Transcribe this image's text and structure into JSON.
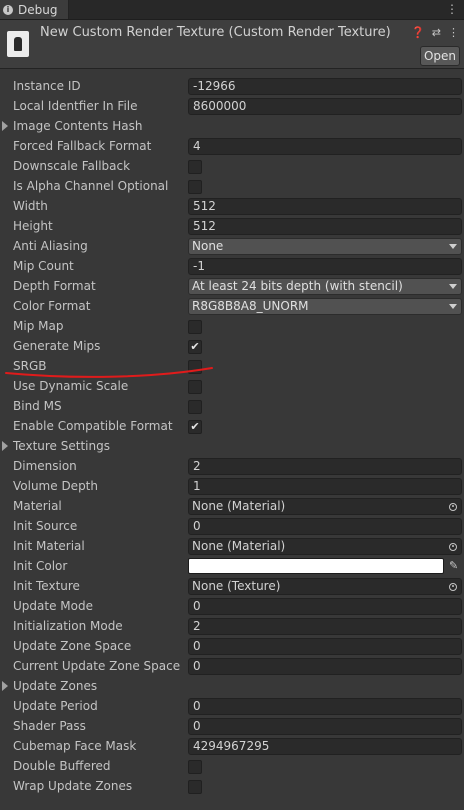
{
  "tab": {
    "label": "Debug",
    "menu_icon": "kebab-menu-icon"
  },
  "header": {
    "title": "New Custom Render Texture (Custom Render Texture)",
    "open_label": "Open",
    "icons": [
      "help-icon",
      "settings-sliders-icon",
      "more-icon"
    ]
  },
  "rows": {
    "instance_id": {
      "label": "Instance ID",
      "value": "-12966"
    },
    "local_identifier": {
      "label": "Local Identfier In File",
      "value": "8600000"
    },
    "image_contents_hash": {
      "label": "Image Contents Hash"
    },
    "forced_fallback_format": {
      "label": "Forced Fallback Format",
      "value": "4"
    },
    "downscale_fallback": {
      "label": "Downscale Fallback",
      "checked": false
    },
    "is_alpha_optional": {
      "label": "Is Alpha Channel Optional",
      "checked": false
    },
    "width": {
      "label": "Width",
      "value": "512"
    },
    "height": {
      "label": "Height",
      "value": "512"
    },
    "anti_aliasing": {
      "label": "Anti Aliasing",
      "value": "None"
    },
    "mip_count": {
      "label": "Mip Count",
      "value": "-1"
    },
    "depth_format": {
      "label": "Depth Format",
      "value": "At least 24 bits depth (with stencil)"
    },
    "color_format": {
      "label": "Color Format",
      "value": "R8G8B8A8_UNORM"
    },
    "mip_map": {
      "label": "Mip Map",
      "checked": false
    },
    "generate_mips": {
      "label": "Generate Mips",
      "checked": true
    },
    "srgb": {
      "label": "SRGB",
      "checked": false
    },
    "use_dynamic_scale": {
      "label": "Use Dynamic Scale",
      "checked": false
    },
    "bind_ms": {
      "label": "Bind MS",
      "checked": false
    },
    "enable_compatible_format": {
      "label": "Enable Compatible Format",
      "checked": true
    },
    "texture_settings": {
      "label": "Texture Settings"
    },
    "dimension": {
      "label": "Dimension",
      "value": "2"
    },
    "volume_depth": {
      "label": "Volume Depth",
      "value": "1"
    },
    "material": {
      "label": "Material",
      "value": "None (Material)"
    },
    "init_source": {
      "label": "Init Source",
      "value": "0"
    },
    "init_material": {
      "label": "Init Material",
      "value": "None (Material)"
    },
    "init_color": {
      "label": "Init Color",
      "color": "#ffffff"
    },
    "init_texture": {
      "label": "Init Texture",
      "value": "None (Texture)"
    },
    "update_mode": {
      "label": "Update Mode",
      "value": "0"
    },
    "initialization_mode": {
      "label": "Initialization Mode",
      "value": "2"
    },
    "update_zone_space": {
      "label": "Update Zone Space",
      "value": "0"
    },
    "current_update_zone_space": {
      "label": "Current Update Zone Space",
      "value": "0"
    },
    "update_zones": {
      "label": "Update Zones"
    },
    "update_period": {
      "label": "Update Period",
      "value": "0"
    },
    "shader_pass": {
      "label": "Shader Pass",
      "value": "0"
    },
    "cubemap_face_mask": {
      "label": "Cubemap Face Mask",
      "value": "4294967295"
    },
    "double_buffered": {
      "label": "Double Buffered",
      "checked": false
    },
    "wrap_update_zones": {
      "label": "Wrap Update Zones",
      "checked": false
    }
  },
  "colors": {
    "background": "#383838",
    "annotation_underline": "#e01b1b"
  }
}
